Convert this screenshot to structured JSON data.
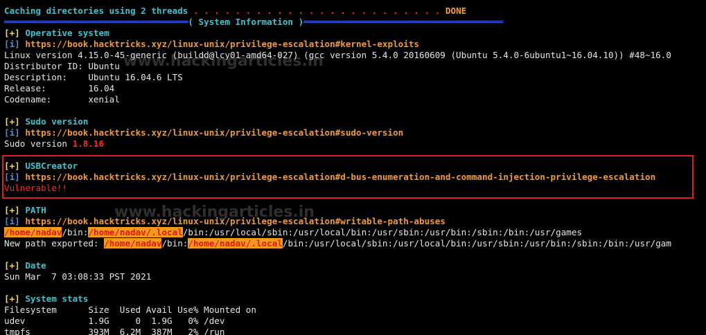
{
  "caching": {
    "text": "Caching directories using 2 threads",
    "dots": " . . . . . . . . . . . . . . . . . . . . . . . . ",
    "status": "DONE"
  },
  "sysinfo": {
    "rule_left": "═══════════════════════════════════",
    "title": "( System Information )",
    "rule_right": "══════════════════════════════════════"
  },
  "os": {
    "header": "Operative system",
    "url": "https://book.hacktricks.xyz/linux-unix/privilege-escalation#kernel-exploits",
    "kernel": "Linux version 4.15.0-45-generic (buildd@lcy01-amd64-027) (gcc version 5.4.0 20160609 (Ubuntu 5.4.0-6ubuntu1~16.04.10)) #48~16.0",
    "distributor": "Distributor ID: Ubuntu",
    "description": "Description:    Ubuntu 16.04.6 LTS",
    "release": "Release:        16.04",
    "codename": "Codename:       xenial"
  },
  "sudo": {
    "header": "Sudo version",
    "url": "https://book.hacktricks.xyz/linux-unix/privilege-escalation#sudo-version",
    "label": "Sudo version ",
    "value": "1.8.16"
  },
  "usb": {
    "header": "USBCreator",
    "url": "https://book.hacktricks.xyz/linux-unix/privilege-escalation#d-bus-enumeration-and-command-injection-privilege-escalation",
    "status": "Vulnerable!!"
  },
  "path": {
    "header": "PATH",
    "url": "https://book.hacktricks.xyz/linux-unix/privilege-escalation#writable-path-abuses",
    "hl1": "/home/nadav",
    "seg1": "/bin:",
    "hl2": "/home/nadav/.local",
    "seg2": "/bin:/usr/local/sbin:/usr/local/bin:/usr/sbin:/usr/bin:/sbin:/bin:/usr/games",
    "exported_label": "New path exported: ",
    "exp_hl1": "/home/nadav",
    "exp_seg1": "/bin:",
    "exp_hl2": "/home/nadav/.local",
    "exp_seg2": "/bin:/usr/local/sbin:/usr/local/bin:/usr/sbin:/usr/bin:/sbin:/bin:/usr/gam"
  },
  "date": {
    "header": "Date",
    "value": "Sun Mar  7 03:08:33 PST 2021"
  },
  "stats": {
    "header": "System stats",
    "columns": "Filesystem      Size  Used Avail Use% Mounted on",
    "rows": [
      "udev            1.9G     0  1.9G   0% /dev",
      "tmpfs           393M  6.2M  387M   2% /run"
    ]
  },
  "markers": {
    "plus": "[+]",
    "info": "[i]"
  },
  "watermarks": {
    "top": "www.hackingarticles.in",
    "middle": "www.hackingarticles.in"
  },
  "colors": {
    "background": "#000000",
    "cyan_header": "#3dc3d0",
    "url_orange": "#f29b34",
    "info_blue": "#4d8ff0",
    "alert_red": "#ff2a2a",
    "highlight_orange": "#f39a1a"
  }
}
